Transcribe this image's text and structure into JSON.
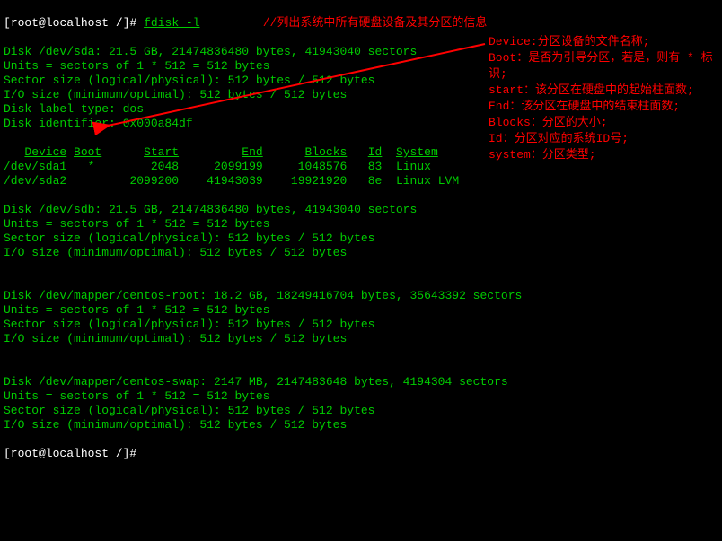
{
  "prompt": {
    "user": "root",
    "host": "localhost",
    "cwd": "/",
    "symbol": "]#",
    "command": "fdisk -l"
  },
  "comment_top": "//列出系统中所有硬盘设备及其分区的信息",
  "disks": [
    {
      "header": "Disk /dev/sda: 21.5 GB, 21474836480 bytes, 41943040 sectors",
      "units": "Units = sectors of 1 * 512 = 512 bytes",
      "sector": "Sector size (logical/physical): 512 bytes / 512 bytes",
      "io": "I/O size (minimum/optimal): 512 bytes / 512 bytes",
      "label": "Disk label type: dos",
      "ident": "Disk identifier: 0x000a84df"
    },
    {
      "header": "Disk /dev/sdb: 21.5 GB, 21474836480 bytes, 41943040 sectors",
      "units": "Units = sectors of 1 * 512 = 512 bytes",
      "sector": "Sector size (logical/physical): 512 bytes / 512 bytes",
      "io": "I/O size (minimum/optimal): 512 bytes / 512 bytes"
    },
    {
      "header": "Disk /dev/mapper/centos-root: 18.2 GB, 18249416704 bytes, 35643392 sectors",
      "units": "Units = sectors of 1 * 512 = 512 bytes",
      "sector": "Sector size (logical/physical): 512 bytes / 512 bytes",
      "io": "I/O size (minimum/optimal): 512 bytes / 512 bytes"
    },
    {
      "header": "Disk /dev/mapper/centos-swap: 2147 MB, 2147483648 bytes, 4194304 sectors",
      "units": "Units = sectors of 1 * 512 = 512 bytes",
      "sector": "Sector size (logical/physical): 512 bytes / 512 bytes",
      "io": "I/O size (minimum/optimal): 512 bytes / 512 bytes"
    }
  ],
  "part_table": {
    "headers": {
      "device": "Device",
      "boot": "Boot",
      "start": "Start",
      "end": "End",
      "blocks": "Blocks",
      "id": "Id",
      "system": "System"
    },
    "rows": [
      {
        "device": "/dev/sda1",
        "boot": "*",
        "start": "2048",
        "end": "2099199",
        "blocks": "1048576",
        "id": "83",
        "system": "Linux"
      },
      {
        "device": "/dev/sda2",
        "boot": " ",
        "start": "2099200",
        "end": "41943039",
        "blocks": "19921920",
        "id": "8e",
        "system": "Linux LVM"
      }
    ]
  },
  "prompt2": "[root@localhost /]#",
  "annotations": [
    "Device:分区设备的文件名称;",
    "Boot：是否为引导分区，若是，则有 * 标识;",
    "start：该分区在硬盘中的起始柱面数;",
    "End：该分区在硬盘中的结束柱面数;",
    "Blocks：分区的大小;",
    "Id：分区对应的系统ID号;",
    "system：分区类型;"
  ]
}
